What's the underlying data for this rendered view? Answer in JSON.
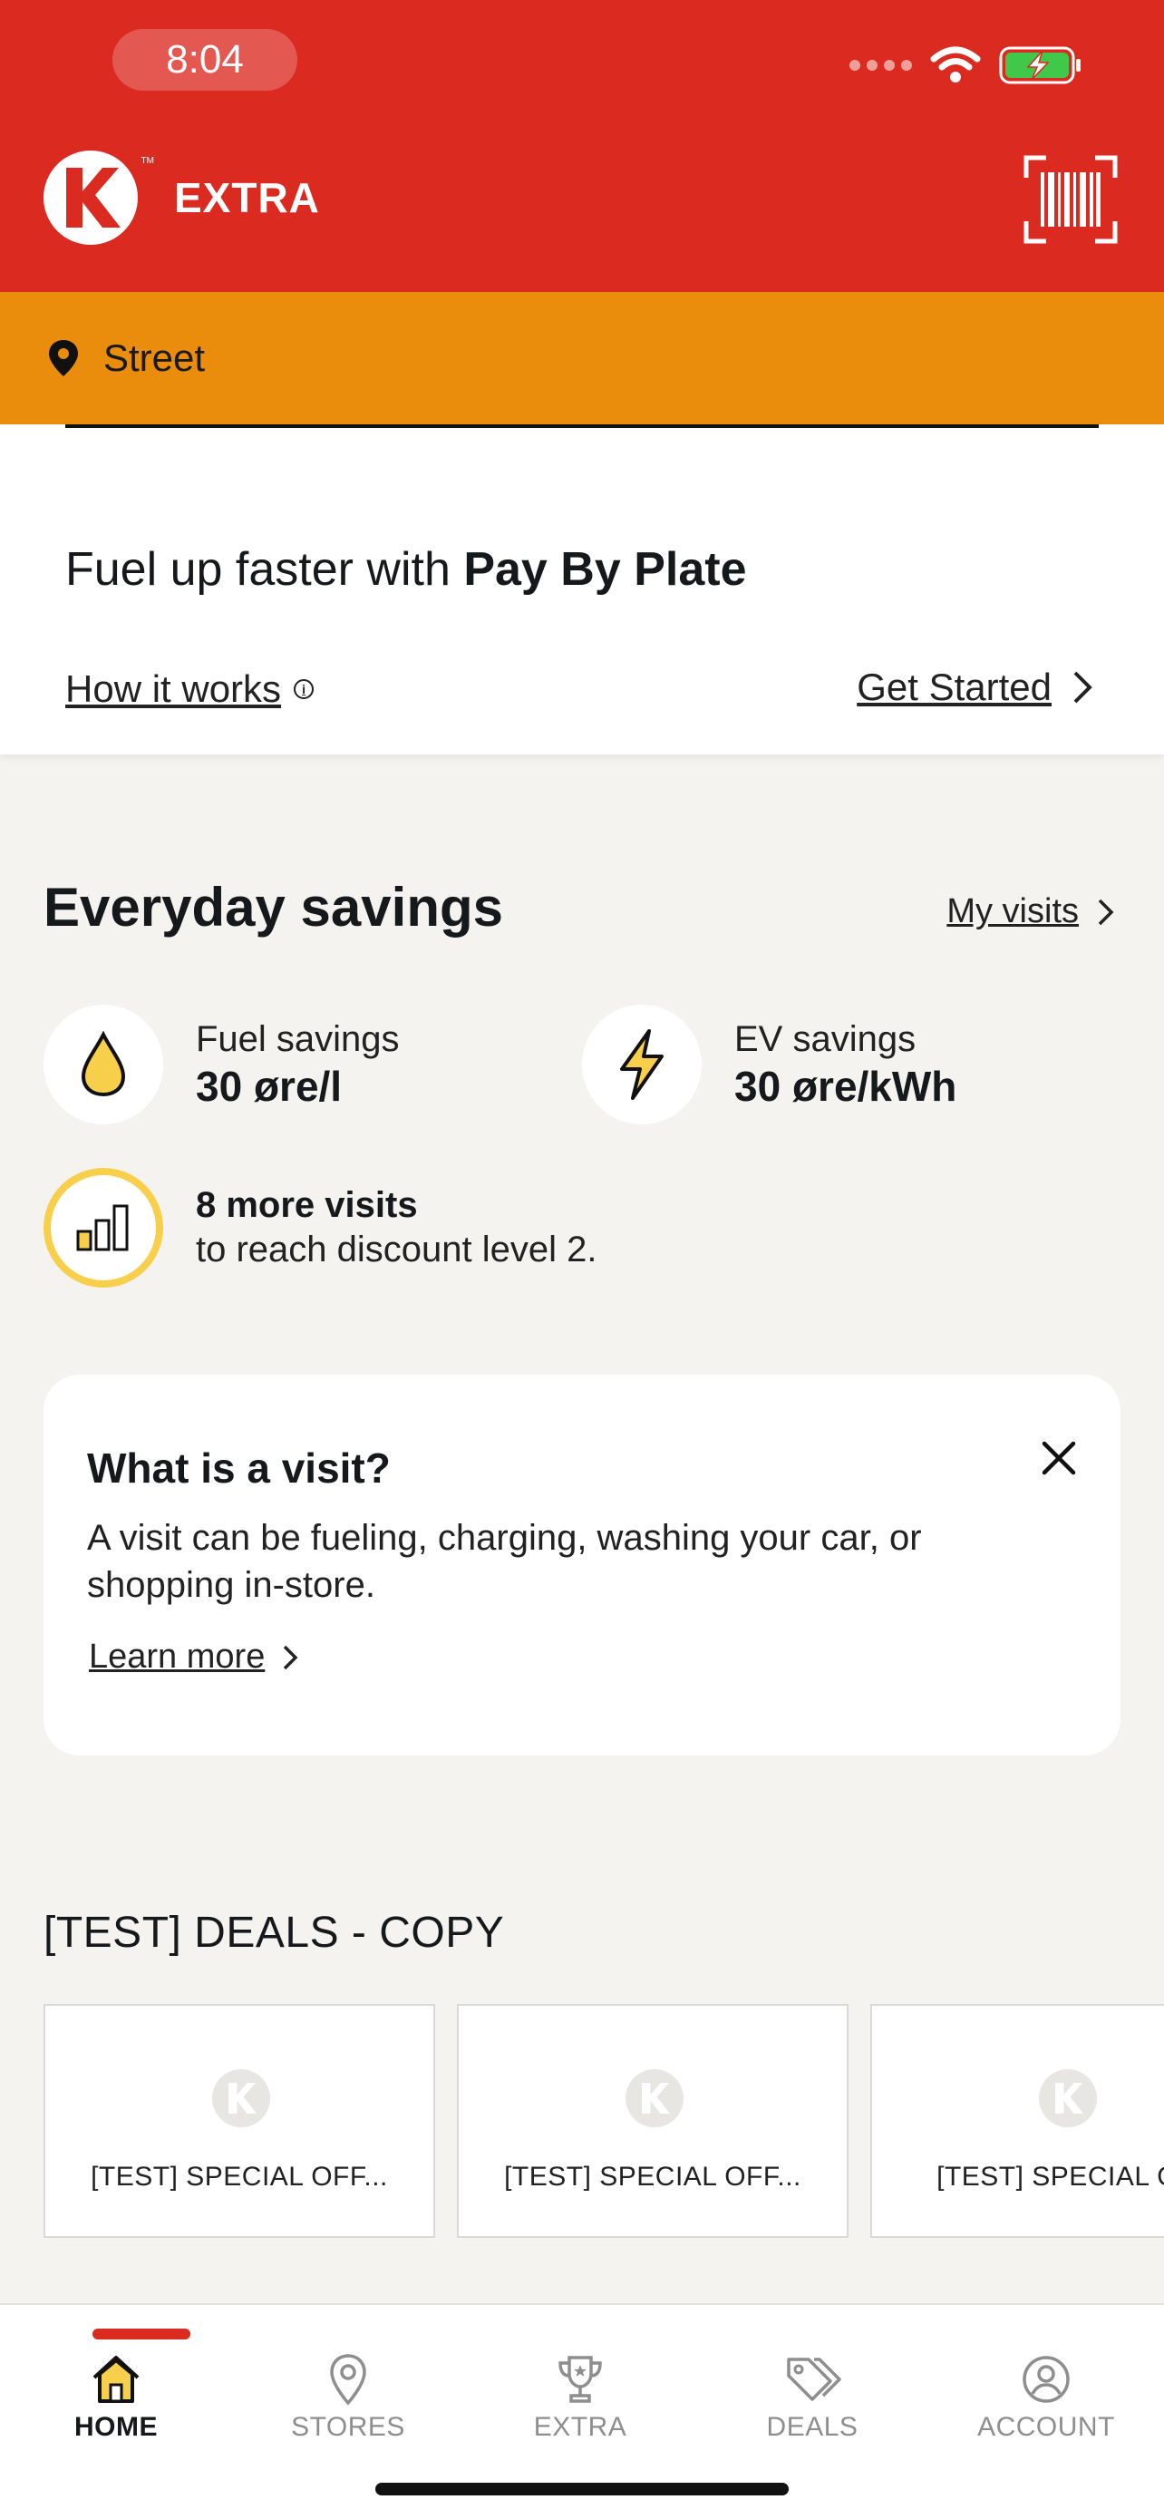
{
  "status_bar": {
    "time": "8:04"
  },
  "header": {
    "brand": "EXTRA",
    "tm": "TM",
    "logo_letter": "K"
  },
  "location": {
    "label": "Street"
  },
  "pay_by_plate": {
    "title_prefix": "Fuel up faster with ",
    "title_bold": "Pay By Plate",
    "how_it_works": "How it works",
    "get_started": "Get Started"
  },
  "savings": {
    "title": "Everyday savings",
    "my_visits": "My visits",
    "fuel": {
      "label": "Fuel savings",
      "value": "30 øre/l"
    },
    "ev": {
      "label": "EV savings",
      "value": "30 øre/kWh"
    },
    "visits": {
      "bold": "8 more visits",
      "sub": "to reach discount level 2."
    }
  },
  "visit_card": {
    "title": "What is a visit?",
    "description": "A visit can be fueling, charging, washing your car, or shopping in-store.",
    "learn_more": "Learn more"
  },
  "deals": {
    "title": "[TEST] DEALS - COPY",
    "items": [
      {
        "label": "[TEST] SPECIAL OFF..."
      },
      {
        "label": "[TEST] SPECIAL OFF..."
      },
      {
        "label": "[TEST] SPECIAL OF"
      }
    ]
  },
  "nav": {
    "items": [
      {
        "label": "HOME",
        "icon": "home-icon",
        "active": true
      },
      {
        "label": "STORES",
        "icon": "map-pin-icon"
      },
      {
        "label": "EXTRA",
        "icon": "trophy-icon"
      },
      {
        "label": "DEALS",
        "icon": "tag-icon"
      },
      {
        "label": "ACCOUNT",
        "icon": "user-circle-icon"
      }
    ]
  },
  "colors": {
    "header": "#db2a20",
    "location_bar": "#ea8c0c",
    "accent_yellow": "#f7cf4b",
    "background": "#f4f3f0"
  }
}
